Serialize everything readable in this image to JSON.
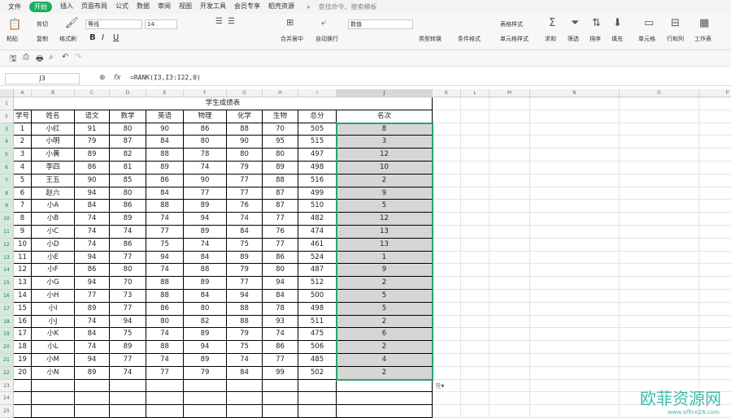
{
  "menu": {
    "file": "文件",
    "tabs": [
      "开始",
      "插入",
      "页面布局",
      "公式",
      "数据",
      "审阅",
      "视图",
      "开发工具",
      "会员专享",
      "稻壳资源"
    ],
    "search": "查找命令、搜索模板"
  },
  "ribbon": {
    "paste": "粘贴",
    "cut": "剪切",
    "copy": "复制",
    "format_painter": "格式刷",
    "font": "等线",
    "size": "14",
    "merge": "合并居中",
    "wrap": "自动换行",
    "number_format": "数值",
    "type_convert": "类型转换",
    "conditional": "条件格式",
    "table_style": "表格样式",
    "cell_style": "单元格样式",
    "sum": "求和",
    "filter": "筛选",
    "sort": "排序",
    "fill": "填充",
    "cells": "单元格",
    "rowcol": "行和列",
    "sheet": "工作表",
    "bold": "B",
    "italic": "I",
    "underline": "U"
  },
  "formula_bar": {
    "name_box": "J3",
    "fx": "fx",
    "formula": "=RANK(I3,I3:I22,0)"
  },
  "columns": [
    "A",
    "B",
    "C",
    "D",
    "E",
    "F",
    "G",
    "H",
    "I",
    "J",
    "K",
    "L",
    "M",
    "N",
    "O",
    "P"
  ],
  "sheet": {
    "title": "学生成绩表",
    "headers": [
      "学号",
      "姓名",
      "语文",
      "数学",
      "英语",
      "物理",
      "化学",
      "生物",
      "总分",
      "名次"
    ],
    "rows": [
      [
        "1",
        "小红",
        "91",
        "80",
        "90",
        "86",
        "88",
        "70",
        "505",
        "8"
      ],
      [
        "2",
        "小明",
        "79",
        "87",
        "84",
        "80",
        "90",
        "95",
        "515",
        "3"
      ],
      [
        "3",
        "小黄",
        "89",
        "82",
        "88",
        "78",
        "80",
        "80",
        "497",
        "12"
      ],
      [
        "4",
        "李四",
        "86",
        "81",
        "89",
        "74",
        "79",
        "89",
        "498",
        "10"
      ],
      [
        "5",
        "王五",
        "90",
        "85",
        "86",
        "90",
        "77",
        "88",
        "516",
        "2"
      ],
      [
        "6",
        "赵六",
        "94",
        "80",
        "84",
        "77",
        "77",
        "87",
        "499",
        "9"
      ],
      [
        "7",
        "小A",
        "84",
        "86",
        "88",
        "89",
        "76",
        "87",
        "510",
        "5"
      ],
      [
        "8",
        "小B",
        "74",
        "89",
        "74",
        "94",
        "74",
        "77",
        "482",
        "12"
      ],
      [
        "9",
        "小C",
        "74",
        "74",
        "77",
        "89",
        "84",
        "76",
        "474",
        "13"
      ],
      [
        "10",
        "小D",
        "74",
        "86",
        "75",
        "74",
        "75",
        "77",
        "461",
        "13"
      ],
      [
        "11",
        "小E",
        "94",
        "77",
        "94",
        "84",
        "89",
        "86",
        "524",
        "1"
      ],
      [
        "12",
        "小F",
        "86",
        "80",
        "74",
        "88",
        "79",
        "80",
        "487",
        "9"
      ],
      [
        "13",
        "小G",
        "94",
        "70",
        "88",
        "89",
        "77",
        "94",
        "512",
        "2"
      ],
      [
        "14",
        "小H",
        "77",
        "73",
        "88",
        "84",
        "94",
        "84",
        "500",
        "5"
      ],
      [
        "15",
        "小I",
        "89",
        "77",
        "86",
        "80",
        "88",
        "78",
        "498",
        "5"
      ],
      [
        "16",
        "小J",
        "74",
        "94",
        "80",
        "82",
        "88",
        "93",
        "511",
        "2"
      ],
      [
        "17",
        "小K",
        "84",
        "75",
        "74",
        "89",
        "79",
        "74",
        "475",
        "6"
      ],
      [
        "18",
        "小L",
        "74",
        "89",
        "88",
        "94",
        "75",
        "86",
        "506",
        "2"
      ],
      [
        "19",
        "小M",
        "94",
        "77",
        "74",
        "89",
        "74",
        "77",
        "485",
        "4"
      ],
      [
        "20",
        "小N",
        "89",
        "74",
        "77",
        "79",
        "84",
        "99",
        "502",
        "2"
      ]
    ]
  },
  "watermark": {
    "brand": "欧菲资源网",
    "url": "www.office26.com"
  }
}
